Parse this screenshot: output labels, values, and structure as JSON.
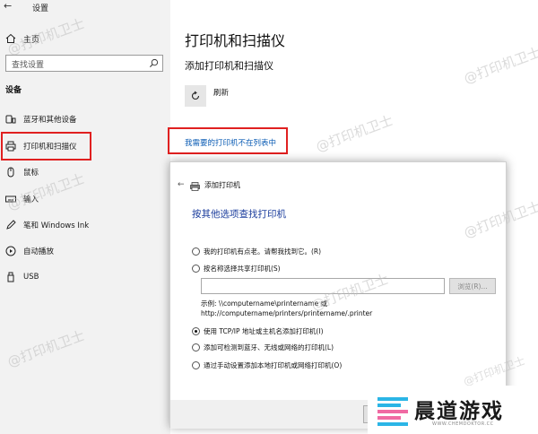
{
  "window": {
    "title": "设置"
  },
  "sidebar": {
    "home": "主页",
    "search_placeholder": "查找设置",
    "section": "设备",
    "items": [
      {
        "label": "蓝牙和其他设备",
        "icon": "bluetooth-devices-icon"
      },
      {
        "label": "打印机和扫描仪",
        "icon": "printer-icon",
        "selected": true
      },
      {
        "label": "鼠标",
        "icon": "mouse-icon"
      },
      {
        "label": "输入",
        "icon": "keyboard-icon"
      },
      {
        "label": "笔和 Windows Ink",
        "icon": "pen-icon"
      },
      {
        "label": "自动播放",
        "icon": "autoplay-icon"
      },
      {
        "label": "USB",
        "icon": "usb-icon"
      }
    ]
  },
  "main": {
    "title": "打印机和扫描仪",
    "subtitle": "添加打印机和扫描仪",
    "refresh": "刷新",
    "not_listed_link": "我需要的打印机不在列表中"
  },
  "dialog": {
    "title": "添加打印机",
    "heading": "按其他选项查找打印机",
    "options": [
      "我的打印机有点老。请帮我找到它。(R)",
      "按名称选择共享打印机(S)",
      "使用 TCP/IP 地址或主机名添加打印机(I)",
      "添加可检测到蓝牙、无线或网络的打印机(L)",
      "通过手动设置添加本地打印机或网络打印机(O)"
    ],
    "selected_option": 2,
    "browse": "浏览(R)...",
    "example_line1": "示例: \\\\computername\\printername 或",
    "example_line2": "http://computername/printers/printername/.printer"
  },
  "watermark": "@打印机卫士",
  "logo": {
    "text": "晨道游戏",
    "url": "WWW.CHEMDOKTOR.CC"
  },
  "colors": {
    "highlight": "#e02020",
    "link": "#0b5cb4",
    "heading": "#1a3c9c"
  }
}
